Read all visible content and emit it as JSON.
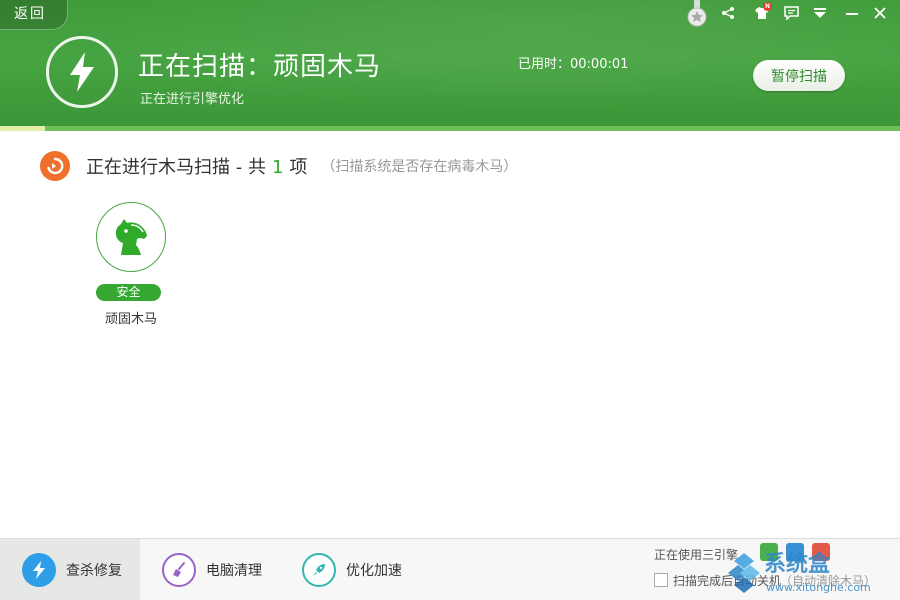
{
  "header": {
    "back_label": "返回",
    "scan_title": "正在扫描：顽固木马",
    "scan_subtitle": "正在进行引擎优化",
    "elapsed": "已用时：00:00:01",
    "pause_label": "暂停扫描",
    "progress_fraction": 0.05,
    "badge_text": "N"
  },
  "toolbar_icons": [
    "medal-icon",
    "share-icon",
    "shirt-icon",
    "message-icon",
    "menu-icon",
    "minimize-icon",
    "close-icon"
  ],
  "section": {
    "title_prefix": "正在进行木马扫描 - 共",
    "count": "1",
    "title_suffix": "项",
    "hint": "（扫描系统是否存在病毒木马）"
  },
  "items": [
    {
      "label": "顽固木马",
      "status": "安全",
      "icon": "horse-icon"
    }
  ],
  "bottom": {
    "tabs": [
      {
        "label": "查杀修复",
        "icon": "bolt-icon",
        "color": "#2f9ee8"
      },
      {
        "label": "电脑清理",
        "icon": "broom-icon",
        "color": "#9a63c9"
      },
      {
        "label": "优化加速",
        "icon": "rocket-icon",
        "color": "#2fb7b0"
      }
    ],
    "engine_text": "正在使用三引擎",
    "checkbox_label": "扫描完成后自动关机",
    "checkbox_hint": "（自动清除木马）",
    "watermark_text": "系统盒",
    "watermark_url": "www.xitonghe.com"
  },
  "colors": {
    "accent_green": "#45a83f",
    "orange": "#f0702b",
    "count_green": "#2faa2b"
  }
}
